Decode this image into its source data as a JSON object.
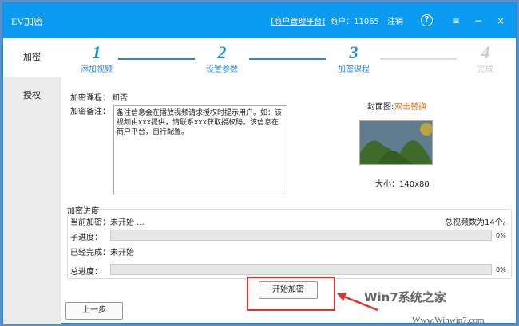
{
  "titlebar": {
    "title": "EV加密",
    "platform_link": "[商户管理平台]",
    "merchant": "商户：11065",
    "logout": "注销",
    "help": "?",
    "menu": "≡",
    "minimize": "−",
    "close": "×"
  },
  "sidebar": {
    "items": [
      {
        "label": "加密",
        "active": true
      },
      {
        "label": "授权",
        "active": false
      }
    ]
  },
  "steps": [
    {
      "num": "1",
      "label": "添加视频",
      "done": true
    },
    {
      "num": "2",
      "label": "设置参数",
      "done": true
    },
    {
      "num": "3",
      "label": "加密课程",
      "done": true
    },
    {
      "num": "4",
      "label": "完成",
      "done": false
    }
  ],
  "form": {
    "course_label": "加密课程：",
    "course_value": "知否",
    "note_label": "加密备注：",
    "note_value": "备注信息会在播放视频请求授权时提示用户。如：该视频由xxx提供，请联系xxx获取授权码。该信息在商户平台，自行配置。",
    "cover_label": "封面图:",
    "cover_action": "双击替换",
    "size_label": "大小：140x80"
  },
  "progress": {
    "group_label": "加密进度",
    "current_label": "当前加密：未开始 ...",
    "total_videos": "总视频数为14个。",
    "sub_label": "子进度：",
    "sub_value": 0,
    "sub_pct": "0%",
    "done_label": "已经完成：未开始",
    "total_label": "总进度：",
    "total_value": 0,
    "total_pct": "0%"
  },
  "buttons": {
    "start": "开始加密",
    "prev": "上一步"
  },
  "watermark": {
    "logo": "Win7系统之家",
    "url": "Www.Winwin7.com"
  },
  "colors": {
    "accent": "#0a9af0",
    "highlight": "#e03030",
    "link_orange": "#f07020"
  }
}
